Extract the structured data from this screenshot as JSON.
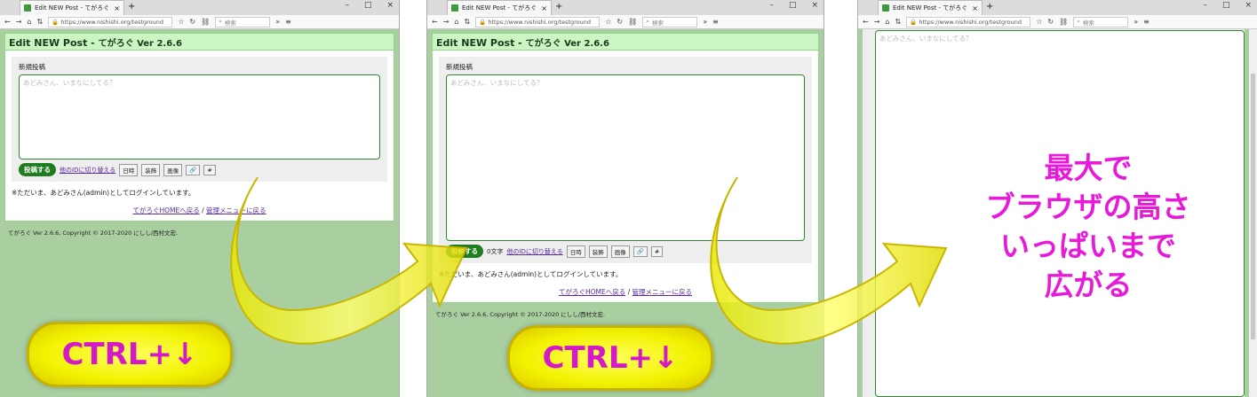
{
  "browser": {
    "tab_title": "Edit NEW Post - てがろぐ",
    "tab_close": "×",
    "new_tab": "+",
    "url": "https://www.nishishi.org/testground",
    "search_placeholder": "検索",
    "win_min": "–",
    "win_max": "□",
    "win_close": "×",
    "menu_icon": "≡",
    "more_icon": "»"
  },
  "page": {
    "header_main": "Edit NEW Post - ",
    "header_jp": "てがろぐ Ver 2.6.6",
    "section_label": "新規投稿",
    "textarea_placeholder": "あどみさん、いまなにしてる？",
    "post_button": "投稿する",
    "char_count": "0文字",
    "switch_id_link": "他のIDに切り替える",
    "btn_date": "日時",
    "btn_decor": "装飾",
    "btn_image": "画像",
    "btn_link": "🔗",
    "btn_hash": "#",
    "login_note": "※ただいま、あどみさん(admin)としてログインしています。",
    "home_link": "てがろぐHOMEへ戻る",
    "separator": " / ",
    "admin_link": "管理メニューに戻る",
    "footer": "てがろぐ Ver 2.6.6, Copyright © 2017-2020 にしし/西村文宏."
  },
  "annotations": {
    "shortcut_1": "CTRL+↓",
    "shortcut_2": "CTRL+↓",
    "result_line1": "最大で",
    "result_line2": "ブラウザの高さ",
    "result_line3": "いっぱいまで",
    "result_line4": "広がる"
  },
  "colors": {
    "header_bg": "#ccf5c4",
    "post_button": "#1e7d1e",
    "annotation_text": "#e81ad9",
    "arrow_yellow": "#f2f200",
    "page_bg_green": "#a9cfa0"
  }
}
